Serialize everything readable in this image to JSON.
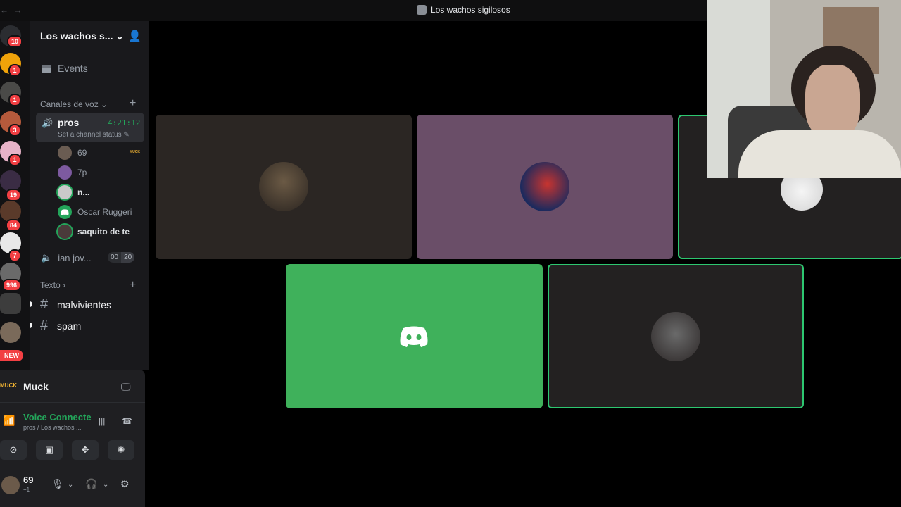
{
  "titlebar": {
    "nav": "← →",
    "title": "Los wachos sigilosos"
  },
  "rail": {
    "badges": [
      "10",
      "1",
      "1",
      "3",
      "1",
      "19",
      "84",
      "7",
      "996"
    ],
    "new_label": "NEW"
  },
  "sidebar": {
    "server_name": "Los wachos s...",
    "events_label": "Events",
    "voice_category": "Canales de voz",
    "active_channel": {
      "name": "pros",
      "time": "4:21:12",
      "status": "Set a channel status"
    },
    "members": [
      {
        "name": "69"
      },
      {
        "name": "7p"
      },
      {
        "name": "n..."
      },
      {
        "name": "Oscar Ruggeri"
      },
      {
        "name": "saquito de te"
      }
    ],
    "muck_tag": "MUCK",
    "second_channel": {
      "name": "ian jov...",
      "count_a": "00",
      "count_b": "20"
    },
    "text_category": "Texto",
    "text_channels": [
      "malvivientes",
      "spam"
    ]
  },
  "activity": {
    "tag": "MUCK",
    "game": "Muck"
  },
  "voice": {
    "title": "Voice Connecte",
    "subtitle": "pros / Los wachos ..."
  },
  "user": {
    "name": "69",
    "sub": "+1"
  },
  "colors": {
    "accent_green": "#23a55a",
    "tile_green": "#3fb15b",
    "tile_purple": "#6a4e68",
    "tile_brown": "#2b2623",
    "tile_dark": "#232121"
  },
  "icons": [
    "calendar-icon",
    "speaker-icon",
    "pencil-icon",
    "hash-icon",
    "signal-icon",
    "waveform-icon",
    "hangup-icon",
    "mic-icon",
    "headphones-icon",
    "gear-icon",
    "screen-share-icon",
    "activities-icon",
    "soundboard-icon",
    "camera-off-icon",
    "discord-logo-icon"
  ]
}
